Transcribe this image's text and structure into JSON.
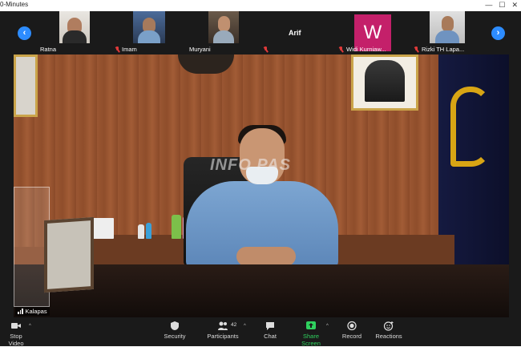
{
  "window": {
    "title": "0-Minutes"
  },
  "participants_strip": {
    "tiles": [
      {
        "name": "Ratna",
        "muted": false
      },
      {
        "name": "Imam",
        "muted": true
      },
      {
        "name": "Muryani",
        "muted": false
      },
      {
        "name": "",
        "muted": true
      },
      {
        "name": "Arif",
        "muted": false
      },
      {
        "name": "Widi Kurniaw...",
        "muted": true,
        "avatar_letter": "W"
      },
      {
        "name": "Rizki TH Lapa...",
        "muted": true
      }
    ]
  },
  "main_video": {
    "speaker_name": "Kalapas",
    "watermark": "INFO PAS"
  },
  "toolbar": {
    "stop_video": "Stop Video",
    "security": "Security",
    "participants": "Participants",
    "participants_count": "42",
    "chat": "Chat",
    "share_screen": "Share Screen",
    "record": "Record",
    "reactions": "Reactions"
  },
  "colors": {
    "accent_blue": "#2d8cff",
    "share_green": "#2fd15e",
    "avatar_magenta": "#c4206a",
    "muted_red": "#e03a3a"
  }
}
